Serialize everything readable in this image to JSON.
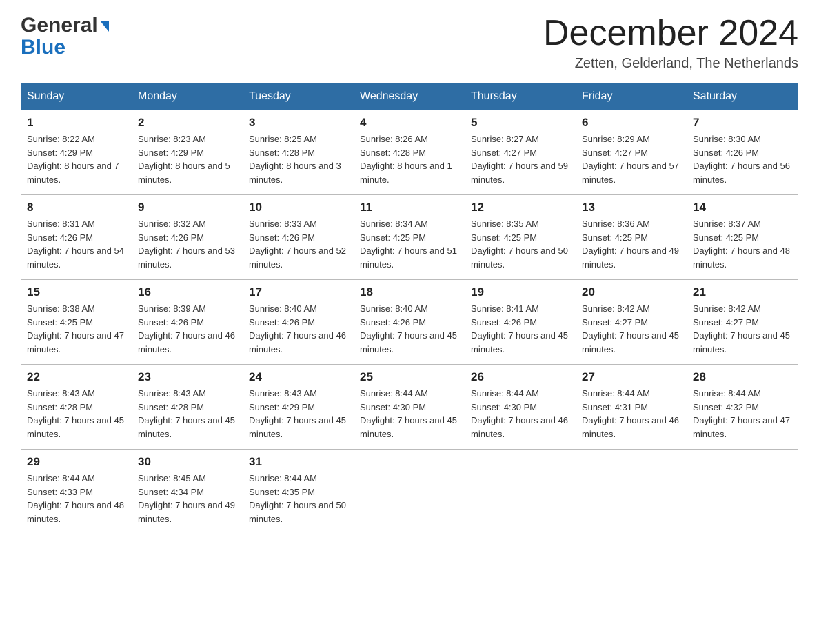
{
  "header": {
    "month_title": "December 2024",
    "location": "Zetten, Gelderland, The Netherlands",
    "logo_general": "General",
    "logo_blue": "Blue"
  },
  "weekdays": [
    "Sunday",
    "Monday",
    "Tuesday",
    "Wednesday",
    "Thursday",
    "Friday",
    "Saturday"
  ],
  "weeks": [
    [
      {
        "day": "1",
        "sunrise": "8:22 AM",
        "sunset": "4:29 PM",
        "daylight": "8 hours and 7 minutes."
      },
      {
        "day": "2",
        "sunrise": "8:23 AM",
        "sunset": "4:29 PM",
        "daylight": "8 hours and 5 minutes."
      },
      {
        "day": "3",
        "sunrise": "8:25 AM",
        "sunset": "4:28 PM",
        "daylight": "8 hours and 3 minutes."
      },
      {
        "day": "4",
        "sunrise": "8:26 AM",
        "sunset": "4:28 PM",
        "daylight": "8 hours and 1 minute."
      },
      {
        "day": "5",
        "sunrise": "8:27 AM",
        "sunset": "4:27 PM",
        "daylight": "7 hours and 59 minutes."
      },
      {
        "day": "6",
        "sunrise": "8:29 AM",
        "sunset": "4:27 PM",
        "daylight": "7 hours and 57 minutes."
      },
      {
        "day": "7",
        "sunrise": "8:30 AM",
        "sunset": "4:26 PM",
        "daylight": "7 hours and 56 minutes."
      }
    ],
    [
      {
        "day": "8",
        "sunrise": "8:31 AM",
        "sunset": "4:26 PM",
        "daylight": "7 hours and 54 minutes."
      },
      {
        "day": "9",
        "sunrise": "8:32 AM",
        "sunset": "4:26 PM",
        "daylight": "7 hours and 53 minutes."
      },
      {
        "day": "10",
        "sunrise": "8:33 AM",
        "sunset": "4:26 PM",
        "daylight": "7 hours and 52 minutes."
      },
      {
        "day": "11",
        "sunrise": "8:34 AM",
        "sunset": "4:25 PM",
        "daylight": "7 hours and 51 minutes."
      },
      {
        "day": "12",
        "sunrise": "8:35 AM",
        "sunset": "4:25 PM",
        "daylight": "7 hours and 50 minutes."
      },
      {
        "day": "13",
        "sunrise": "8:36 AM",
        "sunset": "4:25 PM",
        "daylight": "7 hours and 49 minutes."
      },
      {
        "day": "14",
        "sunrise": "8:37 AM",
        "sunset": "4:25 PM",
        "daylight": "7 hours and 48 minutes."
      }
    ],
    [
      {
        "day": "15",
        "sunrise": "8:38 AM",
        "sunset": "4:25 PM",
        "daylight": "7 hours and 47 minutes."
      },
      {
        "day": "16",
        "sunrise": "8:39 AM",
        "sunset": "4:26 PM",
        "daylight": "7 hours and 46 minutes."
      },
      {
        "day": "17",
        "sunrise": "8:40 AM",
        "sunset": "4:26 PM",
        "daylight": "7 hours and 46 minutes."
      },
      {
        "day": "18",
        "sunrise": "8:40 AM",
        "sunset": "4:26 PM",
        "daylight": "7 hours and 45 minutes."
      },
      {
        "day": "19",
        "sunrise": "8:41 AM",
        "sunset": "4:26 PM",
        "daylight": "7 hours and 45 minutes."
      },
      {
        "day": "20",
        "sunrise": "8:42 AM",
        "sunset": "4:27 PM",
        "daylight": "7 hours and 45 minutes."
      },
      {
        "day": "21",
        "sunrise": "8:42 AM",
        "sunset": "4:27 PM",
        "daylight": "7 hours and 45 minutes."
      }
    ],
    [
      {
        "day": "22",
        "sunrise": "8:43 AM",
        "sunset": "4:28 PM",
        "daylight": "7 hours and 45 minutes."
      },
      {
        "day": "23",
        "sunrise": "8:43 AM",
        "sunset": "4:28 PM",
        "daylight": "7 hours and 45 minutes."
      },
      {
        "day": "24",
        "sunrise": "8:43 AM",
        "sunset": "4:29 PM",
        "daylight": "7 hours and 45 minutes."
      },
      {
        "day": "25",
        "sunrise": "8:44 AM",
        "sunset": "4:30 PM",
        "daylight": "7 hours and 45 minutes."
      },
      {
        "day": "26",
        "sunrise": "8:44 AM",
        "sunset": "4:30 PM",
        "daylight": "7 hours and 46 minutes."
      },
      {
        "day": "27",
        "sunrise": "8:44 AM",
        "sunset": "4:31 PM",
        "daylight": "7 hours and 46 minutes."
      },
      {
        "day": "28",
        "sunrise": "8:44 AM",
        "sunset": "4:32 PM",
        "daylight": "7 hours and 47 minutes."
      }
    ],
    [
      {
        "day": "29",
        "sunrise": "8:44 AM",
        "sunset": "4:33 PM",
        "daylight": "7 hours and 48 minutes."
      },
      {
        "day": "30",
        "sunrise": "8:45 AM",
        "sunset": "4:34 PM",
        "daylight": "7 hours and 49 minutes."
      },
      {
        "day": "31",
        "sunrise": "8:44 AM",
        "sunset": "4:35 PM",
        "daylight": "7 hours and 50 minutes."
      },
      null,
      null,
      null,
      null
    ]
  ]
}
